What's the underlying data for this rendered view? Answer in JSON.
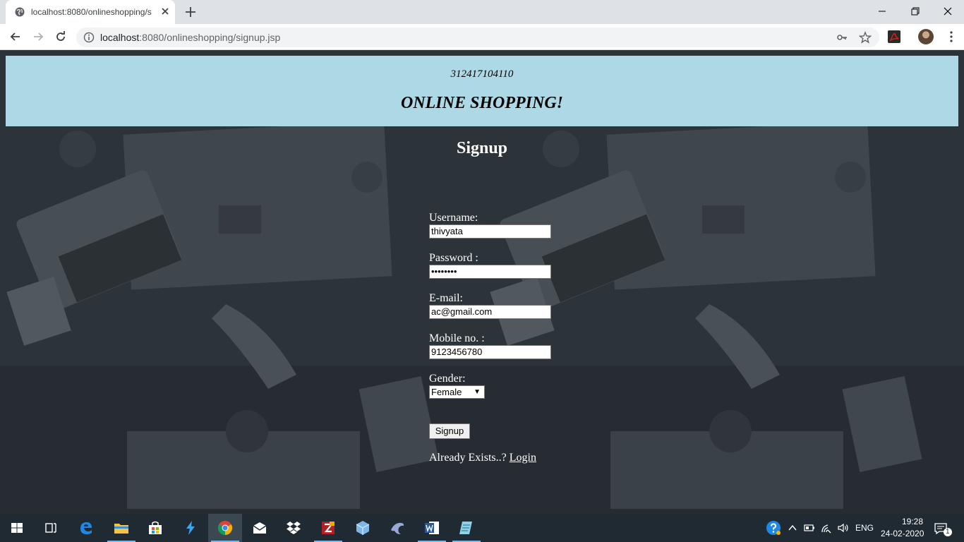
{
  "browser": {
    "tab_title": "localhost:8080/onlineshopping/s",
    "url_host": "localhost",
    "url_rest": ":8080/onlineshopping/signup.jsp"
  },
  "page": {
    "banner_id": "312417104110",
    "banner_title": "ONLINE SHOPPING!",
    "heading": "Signup"
  },
  "form": {
    "username_label": "Username:",
    "username_value": "thivyata",
    "password_label": "Password :",
    "password_value": "••••••••",
    "email_label": "E-mail:",
    "email_value": "ac@gmail.com",
    "mobile_label": "Mobile no. :",
    "mobile_value": "9123456780",
    "gender_label": "Gender:",
    "gender_value": "Female",
    "submit_label": "Signup",
    "already_text": "Already Exists..? ",
    "login_link": "Login"
  },
  "taskbar": {
    "language": "ENG",
    "time": "19:28",
    "date": "24-02-2020",
    "notification_count": "1",
    "apps": [
      "start",
      "task-view",
      "edge",
      "file-explorer",
      "store",
      "visual-studio-code",
      "chrome",
      "mail",
      "dropbox",
      "filezilla",
      "virtualbox",
      "mysql-workbench",
      "word",
      "notepad"
    ]
  },
  "colors": {
    "banner_bg": "#add8e6",
    "page_bg": "#2d3439",
    "taskbar_bg": "#1f2a33"
  }
}
